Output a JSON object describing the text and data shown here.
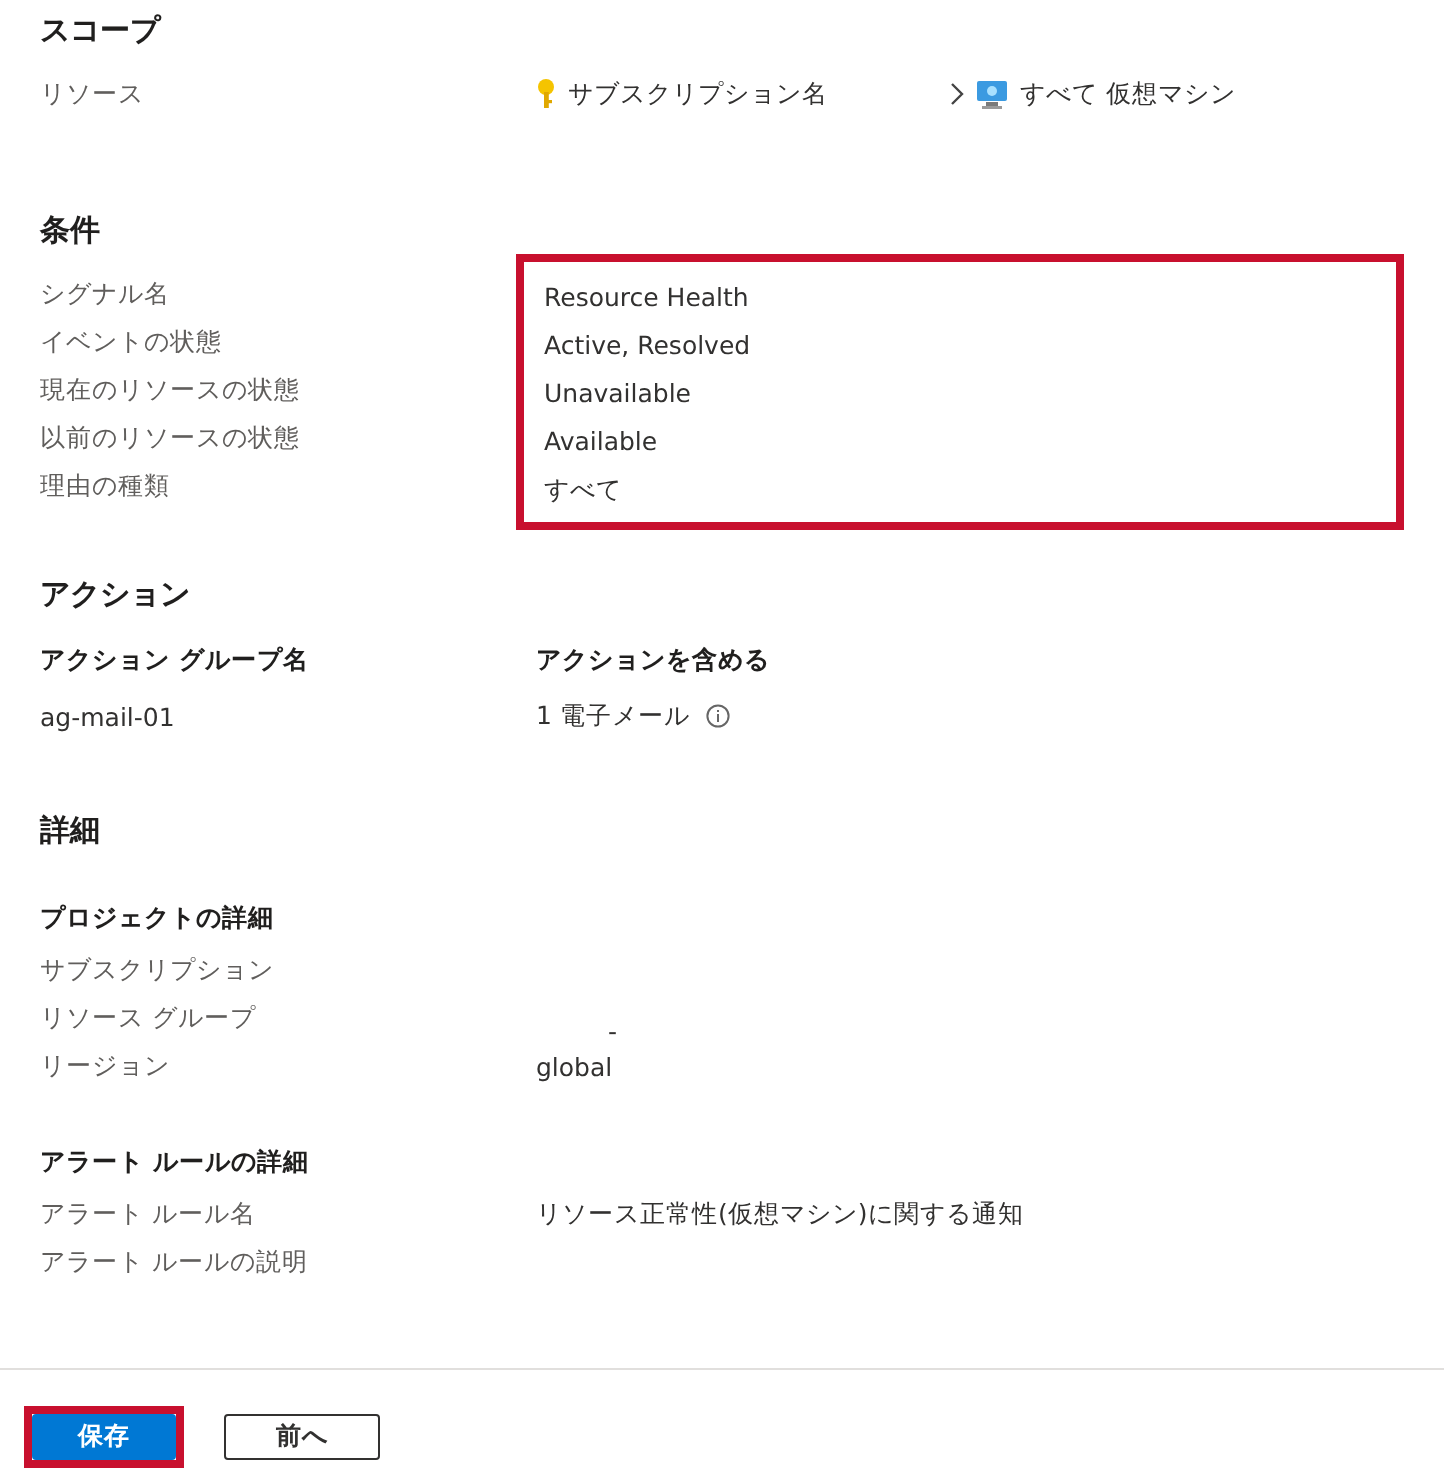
{
  "scope": {
    "heading": "スコープ",
    "rows": [
      {
        "label": "リソース",
        "path": [
          {
            "kind": "key",
            "text": "サブスクリプション名"
          },
          {
            "kind": "vm",
            "text": "すべて 仮想マシン"
          }
        ]
      }
    ]
  },
  "condition": {
    "heading": "条件",
    "highlighted": true,
    "rows": [
      {
        "label": "シグナル名",
        "value": "Resource Health"
      },
      {
        "label": "イベントの状態",
        "value": "Active, Resolved"
      },
      {
        "label": "現在のリソースの状態",
        "value": "Unavailable"
      },
      {
        "label": "以前のリソースの状態",
        "value": "Available"
      },
      {
        "label": "理由の種類",
        "value": "すべて"
      }
    ]
  },
  "actions": {
    "heading": "アクション",
    "columns": [
      "アクション グループ名",
      "アクションを含める"
    ],
    "rows": [
      {
        "group": "ag-mail-01",
        "included": "1 電子メール",
        "info": true
      }
    ]
  },
  "details": {
    "heading": "詳細",
    "groups": [
      {
        "heading": "プロジェクトの詳細",
        "rows": [
          {
            "label": "サブスクリプション"
          },
          {
            "label": "リソース グループ",
            "value": "-"
          },
          {
            "label": "リージョン",
            "value": "global"
          }
        ]
      },
      {
        "heading": "アラート ルールの詳細",
        "rows": [
          {
            "label": "アラート ルール名",
            "value": "リソース正常性(仮想マシン)に関する通知"
          },
          {
            "label": "アラート ルールの説明"
          }
        ]
      }
    ]
  },
  "buttons": [
    {
      "label": "保存",
      "kind": "primary",
      "highlighted": true
    },
    {
      "label": "前へ",
      "kind": "secondary",
      "highlighted": false
    }
  ]
}
